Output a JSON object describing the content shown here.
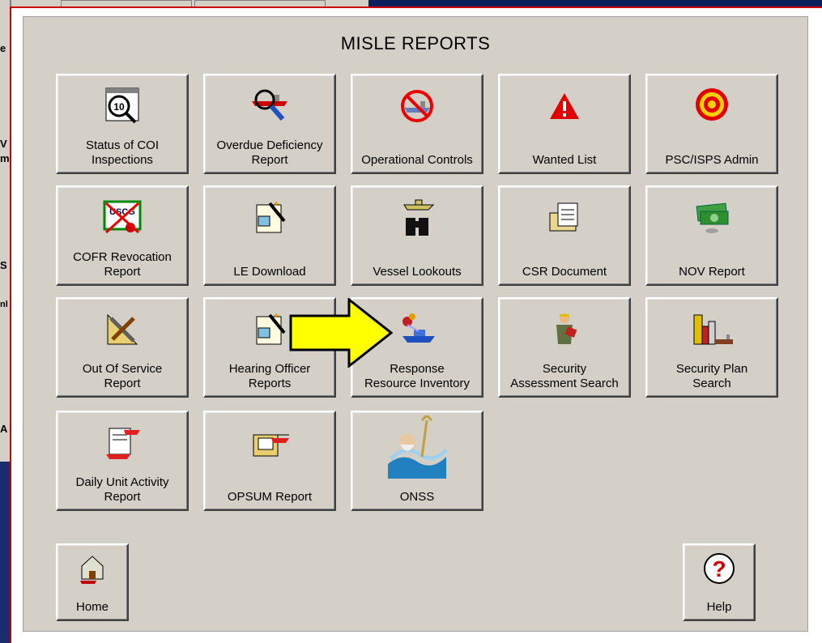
{
  "background": {
    "left_fragments": [
      "e",
      "V",
      "m",
      "S",
      "nl",
      "A"
    ]
  },
  "window": {
    "title": "MISLE REPORTS"
  },
  "reports": [
    {
      "id": "status-coi",
      "label": "Status of COI\nInspections",
      "icon": "coi-inspection-icon"
    },
    {
      "id": "overdue-deficiency",
      "label": "Overdue Deficiency\nReport",
      "icon": "magnifier-vessel-icon"
    },
    {
      "id": "operational-controls",
      "label": "Operational Controls",
      "icon": "no-vessel-icon"
    },
    {
      "id": "wanted-list",
      "label": "Wanted List",
      "icon": "warning-triangle-icon"
    },
    {
      "id": "psc-isps-admin",
      "label": "PSC/ISPS Admin",
      "icon": "target-icon"
    },
    {
      "id": "cofr-revocation",
      "label": "COFR Revocation\nReport",
      "icon": "uscg-certificate-icon"
    },
    {
      "id": "le-download",
      "label": "LE Download",
      "icon": "wizard-notepad-icon"
    },
    {
      "id": "vessel-lookouts",
      "label": "Vessel Lookouts",
      "icon": "binoculars-boat-icon"
    },
    {
      "id": "csr-document",
      "label": "CSR Document",
      "icon": "document-folder-icon"
    },
    {
      "id": "nov-report",
      "label": "NOV Report",
      "icon": "money-icon"
    },
    {
      "id": "out-of-service",
      "label": "Out Of Service\nReport",
      "icon": "tools-icon"
    },
    {
      "id": "hearing-officer",
      "label": "Hearing Officer\nReports",
      "icon": "wizard-notepad-icon"
    },
    {
      "id": "response-resource",
      "label": "Response\nResource Inventory",
      "icon": "fireboat-icon"
    },
    {
      "id": "security-assessment",
      "label": "Security\nAssessment Search",
      "icon": "inspector-icon"
    },
    {
      "id": "security-plan",
      "label": "Security Plan\nSearch",
      "icon": "buildings-ship-icon"
    },
    {
      "id": "daily-unit-activity",
      "label": "Daily Unit Activity\nReport",
      "icon": "helicopter-document-icon"
    },
    {
      "id": "opsum-report",
      "label": "OPSUM Report",
      "icon": "helicopter-folder-icon"
    },
    {
      "id": "onss",
      "label": "ONSS",
      "icon": "neptune-icon"
    }
  ],
  "footer": {
    "home_label": "Home",
    "help_label": "Help"
  },
  "colors": {
    "panel": "#d4d0c8",
    "accent_red": "#d00000",
    "arrow_fill": "#ffff00"
  }
}
